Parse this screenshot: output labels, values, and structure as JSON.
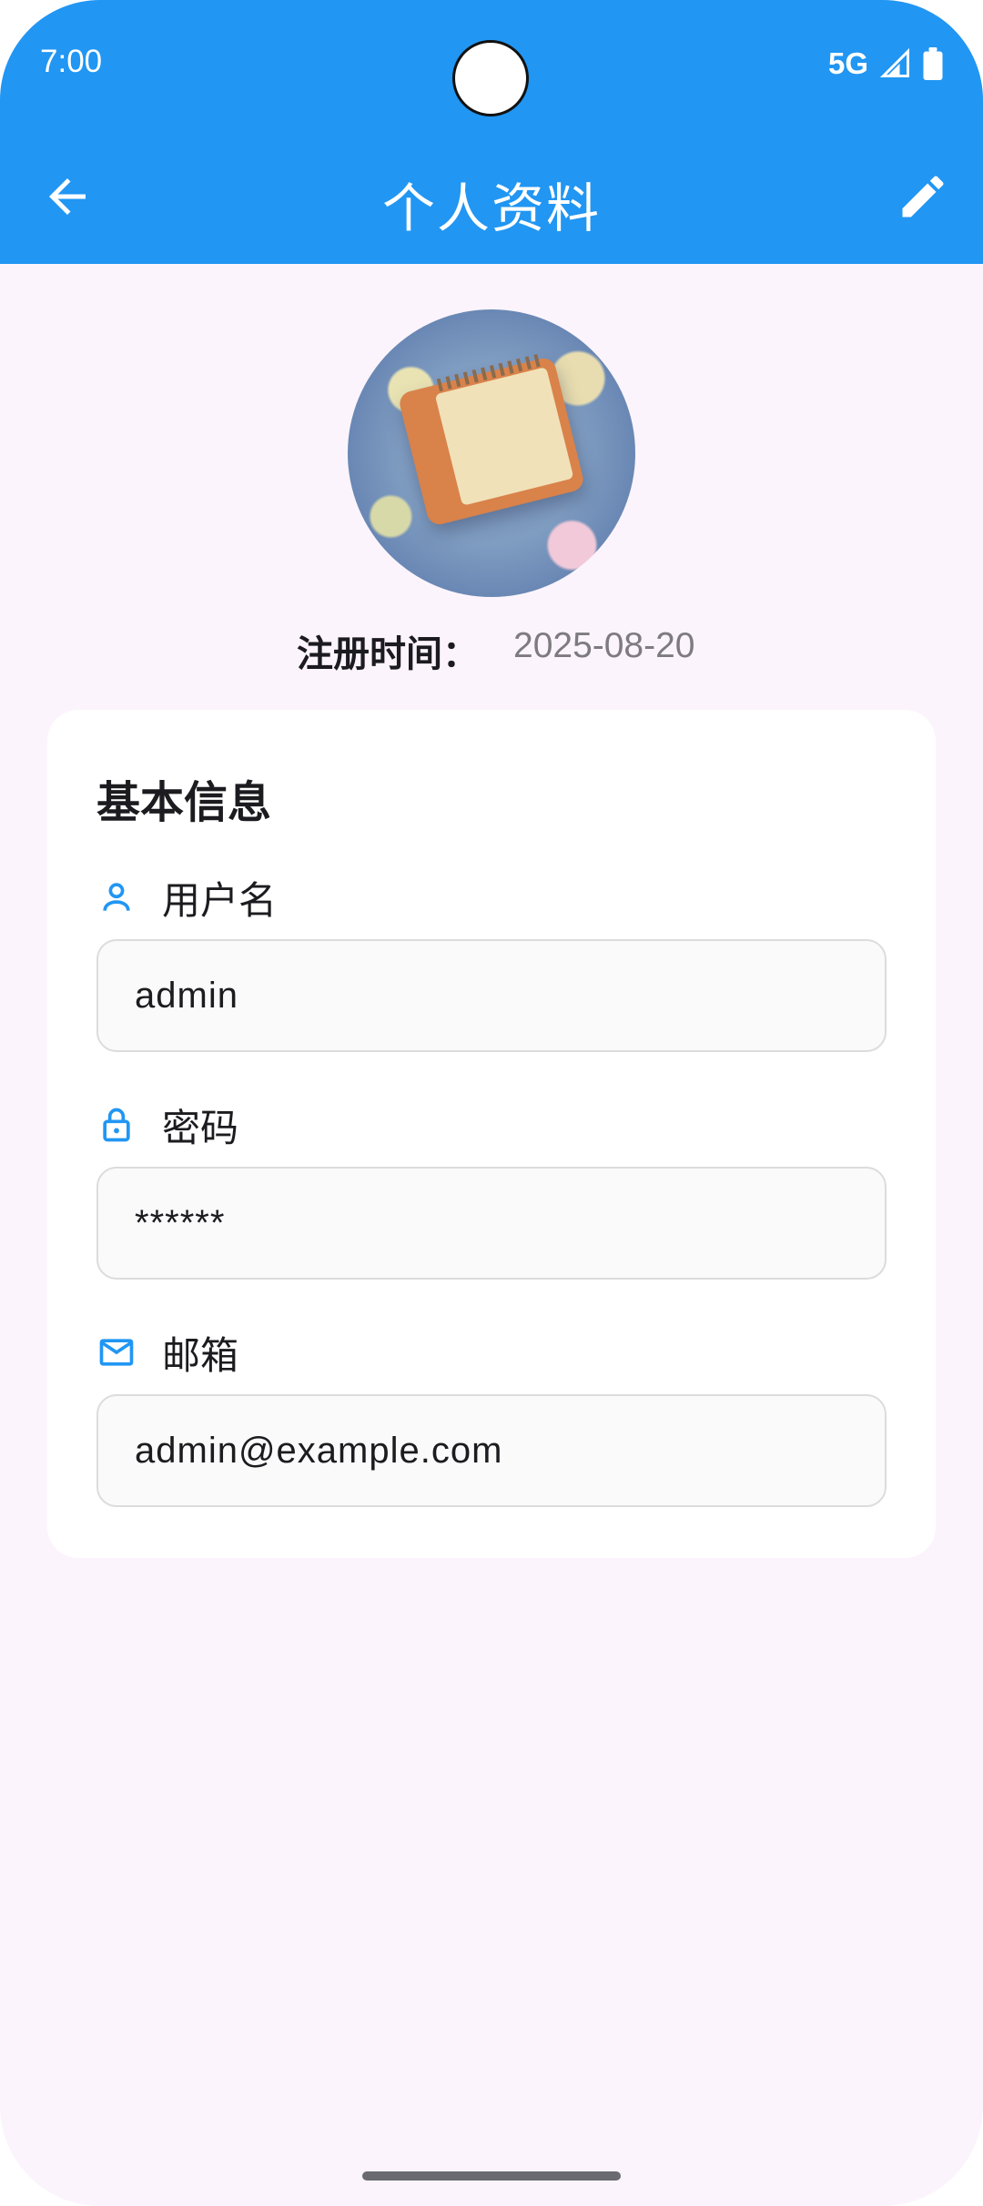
{
  "status_bar": {
    "time": "7:00",
    "network": "5G",
    "icons": [
      "signal-icon",
      "battery-icon"
    ]
  },
  "app_bar": {
    "title": "个人资料",
    "back_icon": "arrow-back-icon",
    "edit_icon": "edit-pencil-icon",
    "color": "#2196f3"
  },
  "profile": {
    "avatar": "notebook-avatar-image",
    "registration_label": "注册时间：",
    "registration_date": "2025-08-20"
  },
  "card": {
    "title": "基本信息",
    "fields": [
      {
        "icon": "person-icon",
        "label": "用户名",
        "value": "admin"
      },
      {
        "icon": "lock-icon",
        "label": "密码",
        "value": "******"
      },
      {
        "icon": "mail-icon",
        "label": "邮箱",
        "value": "admin@example.com"
      }
    ]
  },
  "colors": {
    "accent": "#2196f3",
    "background": "#fcf4fc",
    "card": "#ffffff",
    "text_secondary": "#7d7b80"
  }
}
